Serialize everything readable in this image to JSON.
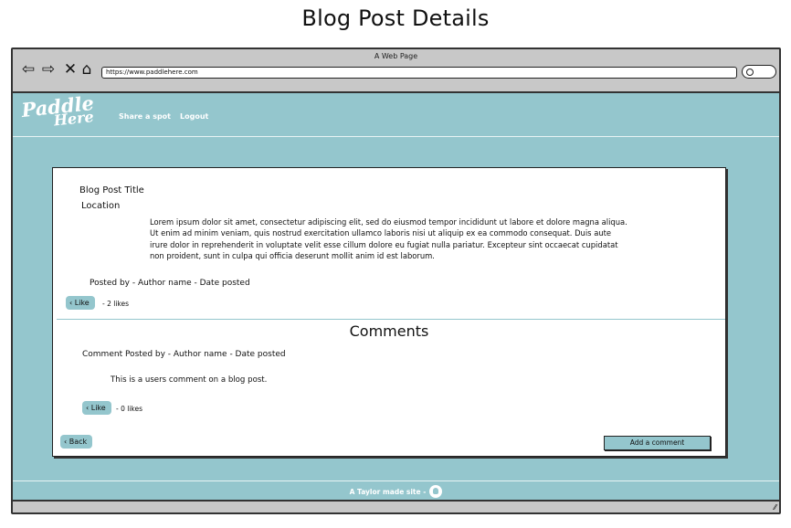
{
  "page_title": "Blog Post Details",
  "browser": {
    "window_title": "A Web Page",
    "url": "https://www.paddlehere.com",
    "icons": [
      "back-arrow-icon",
      "forward-arrow-icon",
      "close-x-icon",
      "home-icon",
      "search-icon",
      "resize-grip-icon"
    ]
  },
  "nav": {
    "logo_line1": "Paddle",
    "logo_line2": "Here",
    "links": [
      "Share a spot",
      "Logout"
    ]
  },
  "post": {
    "title": "Blog Post Title",
    "location": "Location",
    "body": "Lorem ipsum dolor sit amet, consectetur adipiscing elit, sed do eiusmod tempor incididunt ut labore et dolore magna aliqua. Ut enim ad minim veniam, quis nostrud exercitation ullamco laboris nisi ut aliquip ex ea commodo consequat. Duis aute irure dolor in reprehenderit in voluptate velit esse cillum dolore eu fugiat nulla pariatur. Excepteur sint occaecat cupidatat non proident, sunt in culpa qui officia deserunt mollit anim id est laborum.",
    "meta": "Posted by - Author name - Date posted",
    "like_label": "Like",
    "like_count": "- 2 likes"
  },
  "comments": {
    "heading": "Comments",
    "meta": "Comment Posted by - Author name - Date posted",
    "text": "This is a users comment on a blog post.",
    "like_label": "Like",
    "like_count": "- 0 likes"
  },
  "actions": {
    "back_label": "Back",
    "add_comment_label": "Add a comment"
  },
  "footer": {
    "text": "A Taylor made site -"
  },
  "colors": {
    "brand": "#94c6cd",
    "chrome": "#c8c8c8"
  }
}
